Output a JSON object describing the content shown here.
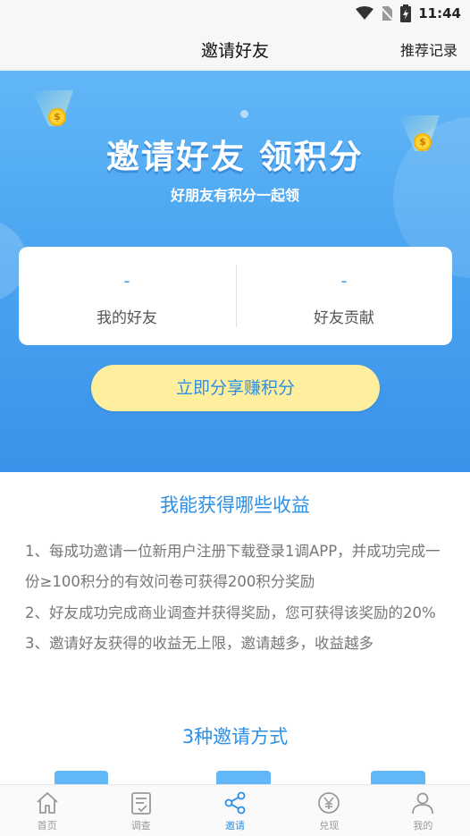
{
  "status_bar": {
    "time": "11:44"
  },
  "header": {
    "title": "邀请好友",
    "records_link": "推荐记录"
  },
  "banner": {
    "title": "邀请好友 领积分",
    "subtitle": "好朋友有积分一起领",
    "coin_symbol": "$"
  },
  "stats": [
    {
      "value": "-",
      "label": "我的好友"
    },
    {
      "value": "-",
      "label": "好友贡献"
    }
  ],
  "share_button": "立即分享赚积分",
  "benefits": {
    "title": "我能获得哪些收益",
    "items": [
      "1、每成功邀请一位新用户注册下载登录1调APP，并成功完成一份≥100积分的有效问卷可获得200积分奖励",
      "2、好友成功完成商业调查并获得奖励，您可获得该奖励的20%",
      "3、邀请好友获得的收益无上限，邀请越多，收益越多"
    ]
  },
  "methods": {
    "title": "3种邀请方式"
  },
  "tabs": [
    {
      "label": "首页",
      "icon": "home-icon"
    },
    {
      "label": "调查",
      "icon": "survey-icon"
    },
    {
      "label": "邀请",
      "icon": "share-icon",
      "active": true
    },
    {
      "label": "兑现",
      "icon": "yen-icon"
    },
    {
      "label": "我的",
      "icon": "profile-icon"
    }
  ],
  "colors": {
    "accent": "#2e8fe3",
    "banner_top": "#62b7f6",
    "banner_bottom": "#3b92ea",
    "button_bg": "#fdef9d"
  }
}
